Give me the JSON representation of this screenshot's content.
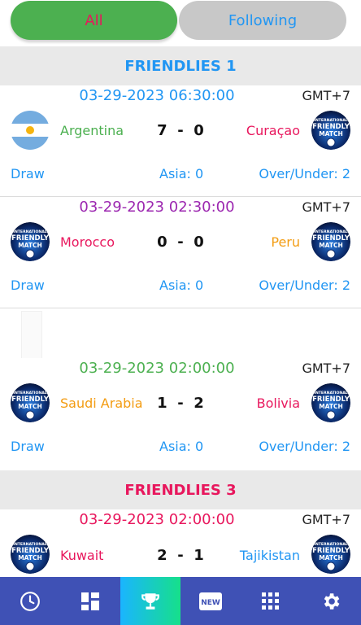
{
  "tabs": {
    "all": "All",
    "following": "Following"
  },
  "sections": [
    {
      "title": "FRIENDLIES 1",
      "color": "#2196f3"
    },
    {
      "title": "FRIENDLIES 3",
      "color": "#e8175d"
    }
  ],
  "matches": [
    {
      "datetime": "03-29-2023 06:30:00",
      "datetime_color": "#2196f3",
      "timezone": "GMT+7",
      "home": "Argentina",
      "home_color": "#4cb050",
      "home_logo": "argentina-flag-icon",
      "score_home": "7",
      "score_sep": "-",
      "score_away": "0",
      "away": "Curaçao",
      "away_color": "#e8175d",
      "away_logo": "friendly-match-logo-icon",
      "draw": "Draw",
      "asia": "Asia: 0",
      "over_under": "Over/Under: 2"
    },
    {
      "datetime": "03-29-2023 02:30:00",
      "datetime_color": "#9c27b0",
      "timezone": "GMT+7",
      "home": "Morocco",
      "home_color": "#e8175d",
      "home_logo": "friendly-match-logo-icon",
      "score_home": "0",
      "score_sep": "-",
      "score_away": "0",
      "away": "Peru",
      "away_color": "#f39c12",
      "away_logo": "friendly-match-logo-icon",
      "draw": "Draw",
      "asia": "Asia: 0",
      "over_under": "Over/Under: 2"
    },
    {
      "datetime": "03-29-2023 02:00:00",
      "datetime_color": "#4cb050",
      "timezone": "GMT+7",
      "home": "Saudi Arabia",
      "home_color": "#f39c12",
      "home_logo": "friendly-match-logo-icon",
      "score_home": "1",
      "score_sep": "-",
      "score_away": "2",
      "away": "Bolivia",
      "away_color": "#e8175d",
      "away_logo": "friendly-match-logo-icon",
      "draw": "Draw",
      "asia": "Asia: 0",
      "over_under": "Over/Under: 2"
    },
    {
      "datetime": "03-29-2023 02:00:00",
      "datetime_color": "#e8175d",
      "timezone": "GMT+7",
      "home": "Kuwait",
      "home_color": "#e8175d",
      "home_logo": "friendly-match-logo-icon",
      "score_home": "2",
      "score_sep": "-",
      "score_away": "1",
      "away": "Tajikistan",
      "away_color": "#2196f3",
      "away_logo": "friendly-match-logo-icon"
    }
  ],
  "logo_text": {
    "line1": "INTERNATIONAL",
    "line2": "FRIENDLY",
    "line3": "MATCH",
    "badge_new": "NEW"
  },
  "bottom_nav": [
    "clock-icon",
    "dashboard-icon",
    "trophy-icon",
    "news-icon",
    "apps-grid-icon",
    "settings-gear-icon"
  ],
  "colors": {
    "nav_bg": "#3f51b5",
    "active_tab": "#4cb050",
    "inactive_tab": "#c8c8c8"
  }
}
